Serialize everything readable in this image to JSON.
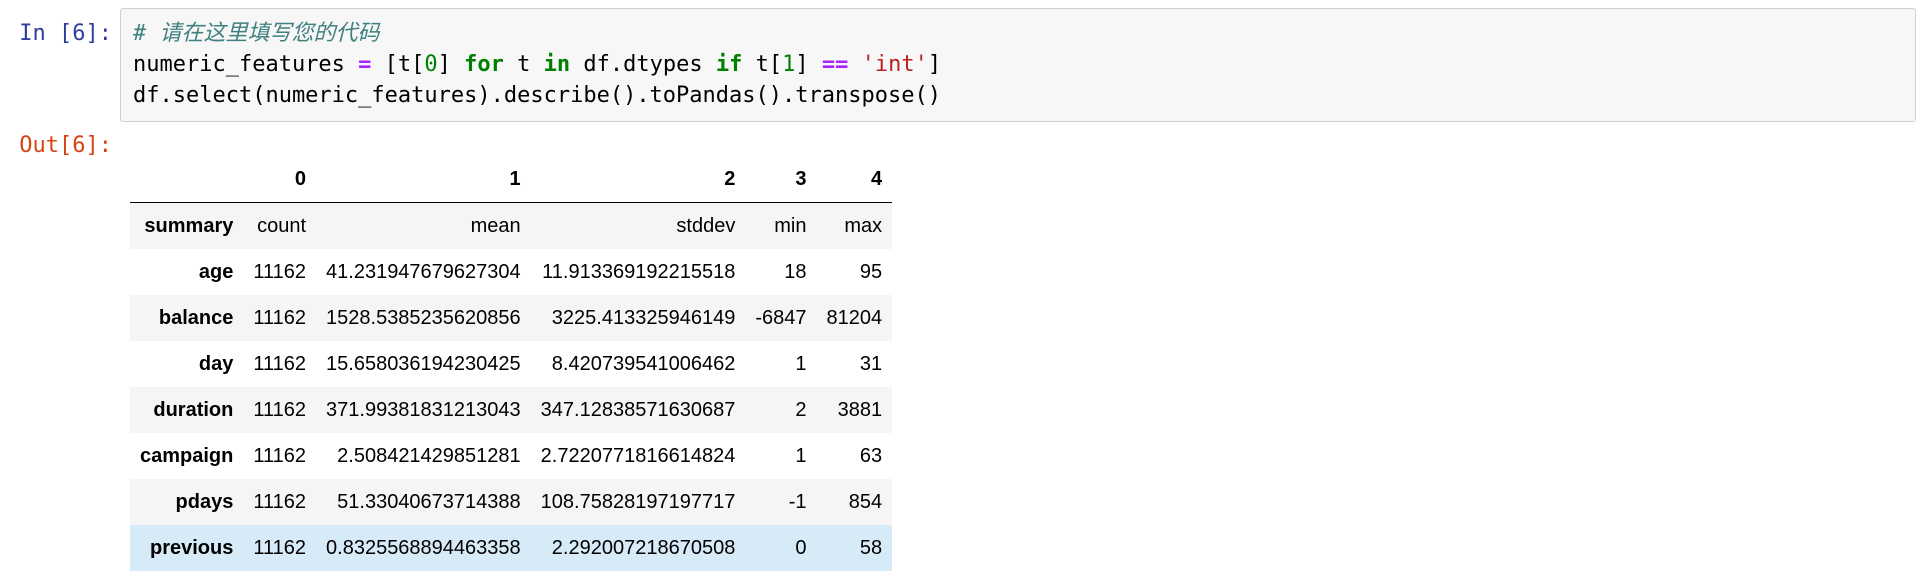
{
  "cell": {
    "in_prompt": "In [6]:",
    "out_prompt": "Out[6]:",
    "code": {
      "comment": "# 请在这里填写您的代码",
      "line2": {
        "var": "numeric_features ",
        "assign": "=",
        "open": " [t[",
        "idx0": "0",
        "mid1": "] ",
        "kw_for": "for",
        "mid2": " t ",
        "kw_in": "in",
        "mid3": " df.dtypes ",
        "kw_if": "if",
        "mid4": " t[",
        "idx1": "1",
        "mid5": "] ",
        "eq": "==",
        "space": " ",
        "str": "'int'",
        "close": "]"
      },
      "line3": "df.select(numeric_features).describe().toPandas().transpose()"
    }
  },
  "table": {
    "columns": [
      "",
      "0",
      "1",
      "2",
      "3",
      "4"
    ],
    "rows": [
      {
        "index": "summary",
        "values": [
          "count",
          "mean",
          "stddev",
          "min",
          "max"
        ]
      },
      {
        "index": "age",
        "values": [
          "11162",
          "41.231947679627304",
          "11.913369192215518",
          "18",
          "95"
        ]
      },
      {
        "index": "balance",
        "values": [
          "11162",
          "1528.5385235620856",
          "3225.413325946149",
          "-6847",
          "81204"
        ]
      },
      {
        "index": "day",
        "values": [
          "11162",
          "15.658036194230425",
          "8.420739541006462",
          "1",
          "31"
        ]
      },
      {
        "index": "duration",
        "values": [
          "11162",
          "371.99381831213043",
          "347.12838571630687",
          "2",
          "3881"
        ]
      },
      {
        "index": "campaign",
        "values": [
          "11162",
          "2.508421429851281",
          "2.7220771816614824",
          "1",
          "63"
        ]
      },
      {
        "index": "pdays",
        "values": [
          "11162",
          "51.33040673714388",
          "108.75828197197717",
          "-1",
          "854"
        ]
      },
      {
        "index": "previous",
        "values": [
          "11162",
          "0.8325568894463358",
          "2.292007218670508",
          "0",
          "58"
        ]
      }
    ]
  }
}
